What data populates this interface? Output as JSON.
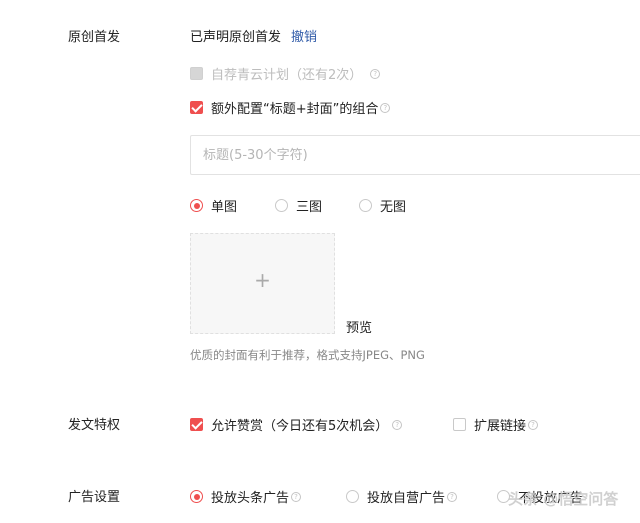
{
  "original": {
    "label": "原创首发",
    "declared_text": "已声明原创首发",
    "revoke_link": "撤销"
  },
  "qingyun": {
    "label": "自荐青云计划（还有2次）",
    "checked": false,
    "disabled": true
  },
  "extra_config": {
    "label": "额外配置“标题+封面”的组合",
    "checked": true
  },
  "title_input": {
    "placeholder": "标题(5-30个字符)",
    "value": ""
  },
  "cover_options": [
    {
      "label": "单图",
      "selected": true
    },
    {
      "label": "三图",
      "selected": false
    },
    {
      "label": "无图",
      "selected": false
    }
  ],
  "cover_upload": {
    "plus_glyph": "+",
    "preview_label": "预览"
  },
  "cover_hint": "优质的封面有利于推荐，格式支持JPEG、PNG",
  "privileges": {
    "label": "发文特权",
    "allow_tip": {
      "label": "允许赞赏（今日还有5次机会）",
      "checked": true
    },
    "extend_link": {
      "label": "扩展链接",
      "checked": false
    }
  },
  "ads": {
    "label": "广告设置",
    "options": [
      {
        "label": "投放头条广告",
        "selected": true
      },
      {
        "label": "投放自营广告",
        "selected": false
      },
      {
        "label": "不投放广告",
        "selected": false
      }
    ]
  },
  "watermark": "头条 @悟空问答",
  "colors": {
    "accent": "#ef4f4f",
    "link": "#2f5aa8"
  }
}
